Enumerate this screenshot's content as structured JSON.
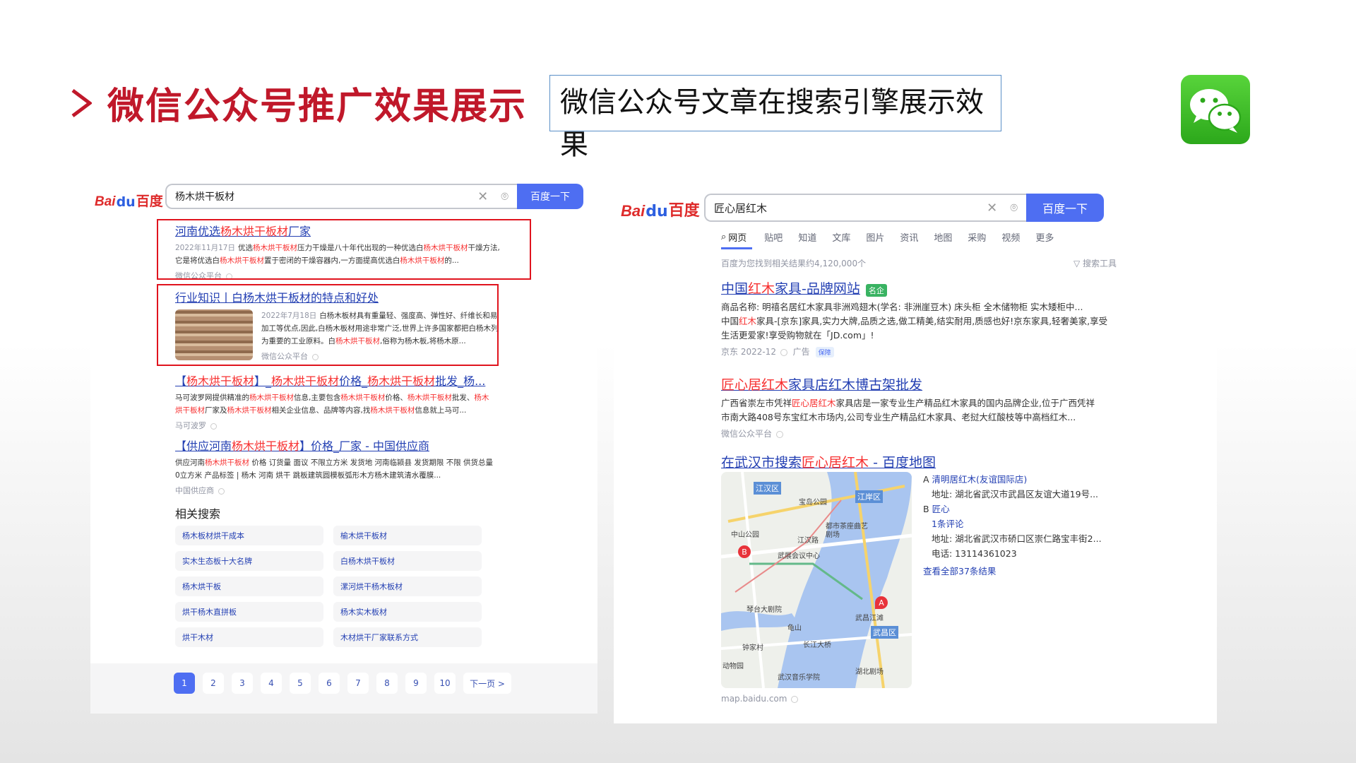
{
  "slide": {
    "title": "微信公众号推广效果展示",
    "subtitle": "微信公众号文章在搜索引擎展示效果"
  },
  "colors": {
    "title_red": "#c0182a",
    "baidu_blue": "#4e6ef2",
    "link_blue": "#2440b3",
    "highlight_red": "#f73131",
    "box_red": "#e0141e"
  },
  "left": {
    "logo": {
      "bai": "Bai",
      "paw": "du",
      "cn": "百度"
    },
    "query": "杨木烘干板材",
    "button": "百度一下",
    "results": [
      {
        "title_pre": "河南优选",
        "title_hl": "杨木烘干板材",
        "title_post": "厂家",
        "date": "2022年11月17日",
        "l1_a": "优选",
        "l1_hl1": "杨木烘干板材",
        "l1_b": "压力干燥是八十年代出现的一种优选白",
        "l1_hl2": "杨木烘干板材",
        "l1_c": "干燥方法,",
        "l2_a": "它是将优选白",
        "l2_hl1": "杨木烘干板材",
        "l2_b": "置于密闭的干燥容器内,一方面提高优选白",
        "l2_hl2": "杨木烘干板材",
        "l2_c": "的...",
        "source": "微信公众平台"
      },
      {
        "title": "行业知识丨白杨木烘干板材的特点和好处",
        "date": "2022年7月18日",
        "l1": "白杨木板材具有重量轻、强度高、弹性好、纤维长和易",
        "l2": "加工等优点,因此,白杨木板材用途非常广泛,世界上许多国家都把白杨木列",
        "l3_a": "为重要的工业原料。白",
        "l3_hl": "杨木烘干板材",
        "l3_b": ",俗称为杨木板,将杨木原...",
        "source": "微信公众平台"
      },
      {
        "title_pre": "【",
        "title_hl1": "杨木烘干板材",
        "title_mid1": "】_",
        "title_hl2": "杨木烘干板材",
        "title_mid2": "价格_",
        "title_hl3": "杨木烘干板材",
        "title_post": "批发_杨...",
        "l1_a": "马可波罗网提供精准的",
        "l1_hl1": "杨木烘干板材",
        "l1_b": "信息,主要包含",
        "l1_hl2": "杨木烘干板材",
        "l1_c": "价格、",
        "l1_hl3": "杨木烘干板材",
        "l1_d": "批发、",
        "l1_hl4": "杨木",
        "l2_hl1": "烘干板材",
        "l2_a": "厂家及",
        "l2_hl2": "杨木烘干板材",
        "l2_b": "相关企业信息、品牌等内容,找",
        "l2_hl3": "杨木烘干板材",
        "l2_c": "信息就上马可...",
        "source": "马可波罗"
      },
      {
        "title_pre": "【供应河南",
        "title_hl": "杨木烘干板材",
        "title_post": "】价格_厂家 - 中国供应商",
        "l1_a": "供应河南",
        "l1_hl": "杨木烘干板材",
        "l1_b": " 价格 订货量 面议 不限立方米 发货地 河南临颍县 发货期限 不限 供货总量",
        "l2": "0立方米 产品标签 | 杨木 河南 烘干 跳板建筑圆模板弧形木方杨木建筑清水覆膜...",
        "source": "中国供应商"
      }
    ],
    "related_title": "相关搜索",
    "related": [
      "杨木板材烘干成本",
      "榆木烘干板材",
      "实木生态板十大名牌",
      "白杨木烘干板材",
      "杨木烘干板",
      "漯河烘干杨木板材",
      "烘干杨木直拼板",
      "杨木实木板材",
      "烘干木材",
      "木材烘干厂家联系方式"
    ],
    "pages": [
      "1",
      "2",
      "3",
      "4",
      "5",
      "6",
      "7",
      "8",
      "9",
      "10"
    ],
    "next": "下一页 >"
  },
  "right": {
    "logo": {
      "bai": "Bai",
      "paw": "du",
      "cn": "百度"
    },
    "query": "匠心居红木",
    "button": "百度一下",
    "tabs": [
      "网页",
      "贴吧",
      "知道",
      "文库",
      "图片",
      "资讯",
      "地图",
      "采购",
      "视频",
      "更多"
    ],
    "count": "百度为您找到相关结果约4,120,000个",
    "tools": "搜索工具",
    "results": [
      {
        "title_pre": "中国",
        "title_hl": "红木",
        "title_post": "家具-品牌网站",
        "badge": "名企",
        "l1": "商品名称: 明禧名居红木家具非洲鸡翅木(学名: 非洲崖豆木) 床头柜 全木储物柜 实木矮柜中...",
        "l2_a": "中国",
        "l2_hl": "红木",
        "l2_b": "家具-[京东]家具,实力大牌,品质之选,做工精美,结实耐用,质感也好!京东家具,轻奢美家,享受",
        "l3": "生活更爱家!享受购物就在「JD.com」!",
        "source": "京东 2022-12",
        "ad": "广告",
        "guarantee": "保障"
      },
      {
        "title_hl": "匠心居红木",
        "title_post": "家具店红木博古架批发",
        "l1_a": "广西省崇左市凭祥",
        "l1_hl": "匠心居红木",
        "l1_b": "家具店是一家专业生产精品红木家具的国内品牌企业,位于广西凭祥",
        "l2": "市南大路408号东宝红木市场内,公司专业生产精品红木家具、老挝大红酸枝等中高档红木...",
        "source": "微信公众平台"
      },
      {
        "title_pre": "在武汉市搜索",
        "title_hl": "匠心居红木",
        "title_post": " - 百度地图"
      }
    ],
    "map_labels": [
      "江汉区",
      "江岸区",
      "武昌区",
      "中山公园",
      "江汉路",
      "武展会议中心",
      "宝岛公园",
      "都市茶座曲艺剧场",
      "琴台大剧院",
      "龟山",
      "钟家村",
      "长江大桥",
      "武昌江滩",
      "武汉音乐学院",
      "湖北剧场",
      "动物园"
    ],
    "map_markers": [
      "A",
      "B"
    ],
    "places": {
      "a_label": "A",
      "a_name": "清明居红木(友谊国际店)",
      "a_addr": "地址: 湖北省武汉市武昌区友谊大道19号...",
      "b_label": "B",
      "b_name": "匠心",
      "b_reviews": "1条评论",
      "b_addr": "地址: 湖北省武汉市硚口区崇仁路宝丰街2...",
      "b_phone": "电话: 13114361023",
      "all": "查看全部37条结果"
    },
    "map_source": "map.baidu.com"
  }
}
